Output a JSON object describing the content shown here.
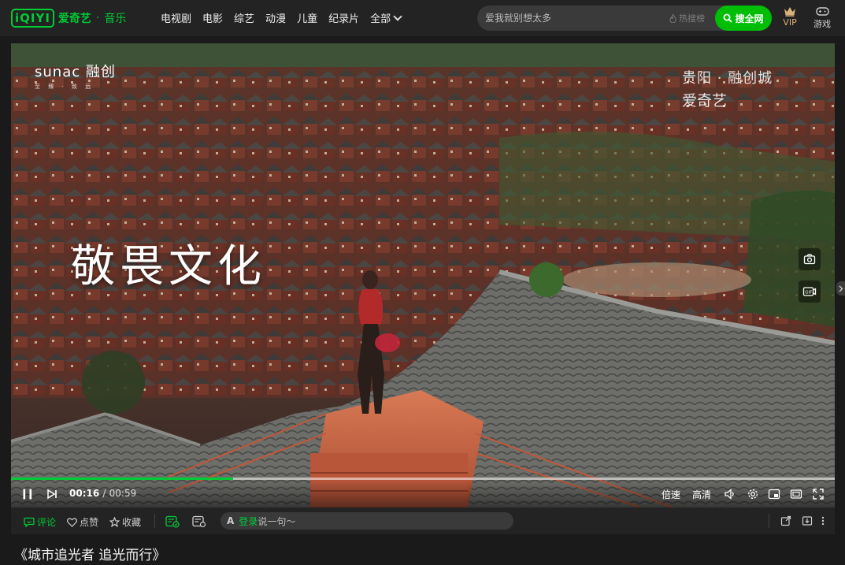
{
  "brand": {
    "logo": "iQIYI",
    "name": "爱奇艺",
    "separator": "·",
    "channel": "音乐"
  },
  "nav": {
    "items": [
      "电视剧",
      "电影",
      "综艺",
      "动漫",
      "儿童",
      "纪录片"
    ],
    "more": "全部"
  },
  "search": {
    "placeholder": "爱我就别想太多",
    "hot_label": "热搜榜",
    "button": "搜全网"
  },
  "header_right": {
    "vip": "VIP",
    "game": "游戏"
  },
  "video": {
    "watermark_left_brand": "sunac 融创",
    "watermark_left_tagline": "至 臻 · 致 远",
    "watermark_right_city": "贵阳 · 融创城",
    "watermark_right_logo": "爱奇艺",
    "overlay_caption": "敬畏文化",
    "progress_fraction": 0.27
  },
  "player_controls": {
    "current_time": "00:16",
    "time_separator": "/",
    "duration": "00:59",
    "speed": "倍速",
    "quality": "高清"
  },
  "actions": {
    "comment": "评论",
    "like": "点赞",
    "favorite": "收藏",
    "comment_prefix": "A",
    "login": "登录",
    "comment_hint": "说一句～"
  },
  "page": {
    "title": "《城市追光者 追光而行》"
  },
  "colors": {
    "accent": "#00cc36",
    "search_button": "#00be06",
    "background": "#1a1a1a",
    "bar": "#232323",
    "vip_gold": "#d8b27a"
  },
  "icons": [
    "search-icon",
    "fire-icon",
    "crown-icon",
    "gamepad-icon",
    "camera-icon",
    "gif-icon",
    "pause-icon",
    "next-icon",
    "volume-icon",
    "settings-icon",
    "pip-icon",
    "widescreen-icon",
    "fullscreen-icon",
    "comment-icon",
    "heart-icon",
    "star-icon",
    "danmaku-icon",
    "danmaku-settings-icon",
    "share-icon",
    "download-icon",
    "more-icon",
    "chevron-right-icon"
  ]
}
